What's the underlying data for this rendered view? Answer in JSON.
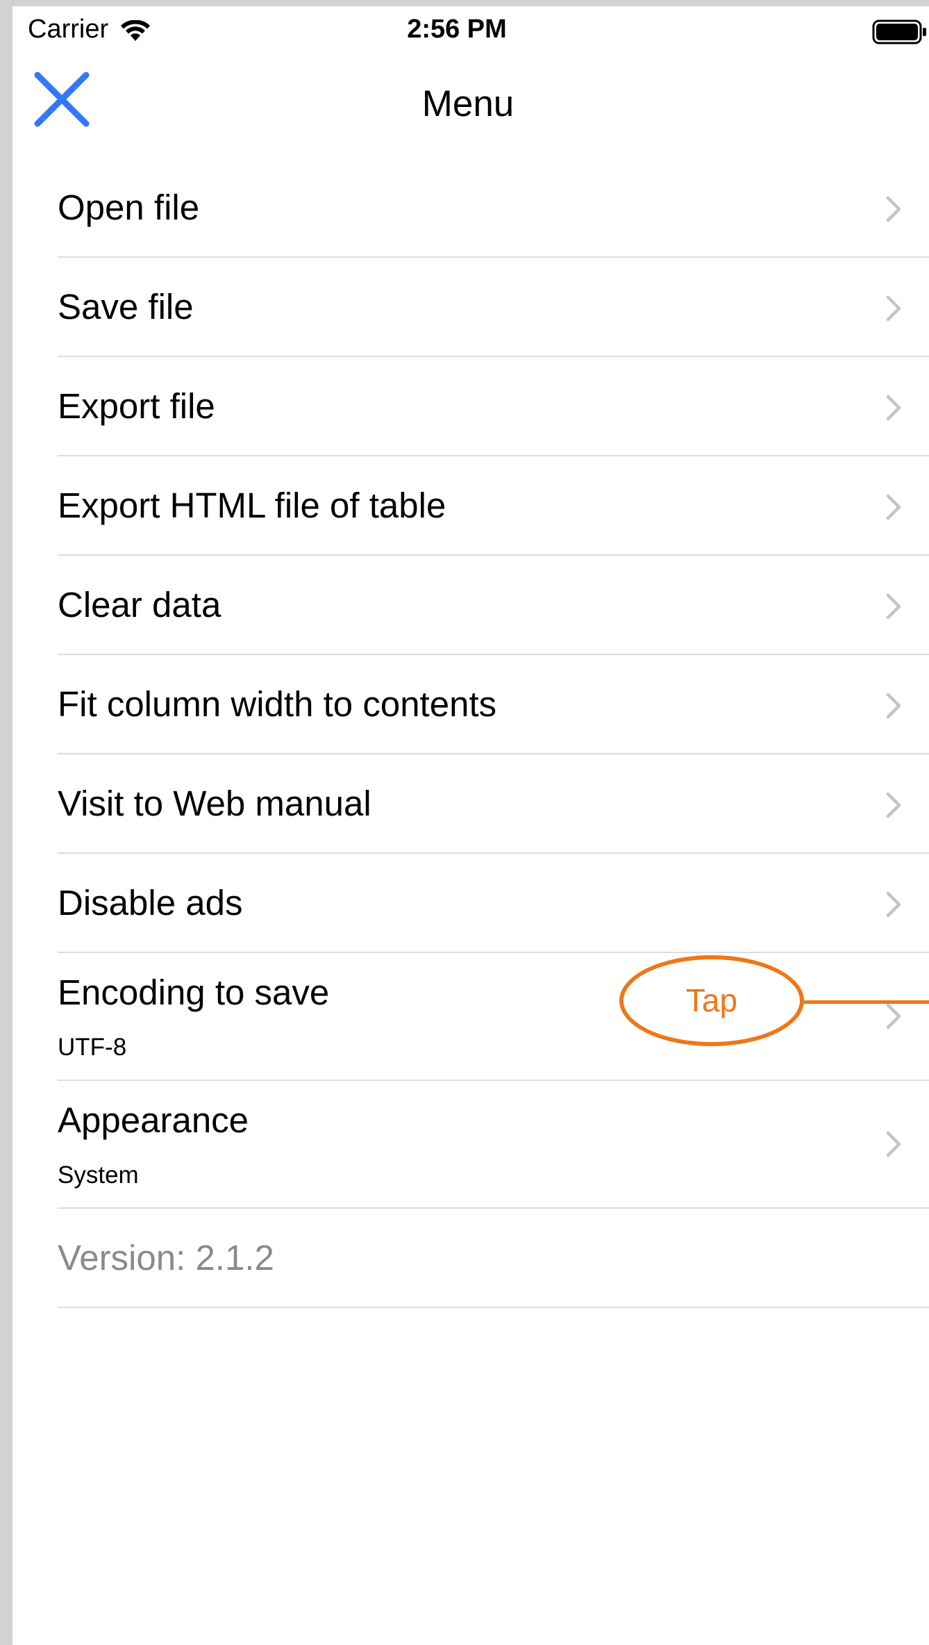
{
  "status_bar": {
    "carrier": "Carrier",
    "time": "2:56 PM",
    "wifi_icon": "wifi-icon",
    "battery_icon": "battery-icon"
  },
  "nav": {
    "title": "Menu",
    "close_icon": "close-icon",
    "accent_color": "#3478f6"
  },
  "menu": {
    "items": [
      {
        "label": "Open file"
      },
      {
        "label": "Save file"
      },
      {
        "label": "Export file"
      },
      {
        "label": "Export HTML file of table"
      },
      {
        "label": "Clear data"
      },
      {
        "label": "Fit column width to contents"
      },
      {
        "label": "Visit to Web manual"
      },
      {
        "label": "Disable ads"
      },
      {
        "label": "Encoding to save",
        "value": "UTF-8"
      },
      {
        "label": "Appearance",
        "value": "System"
      }
    ],
    "version": "Version: 2.1.2",
    "chevron_icon": "chevron-right-icon"
  },
  "annotation": {
    "label": "Tap",
    "color": "#ee7717"
  }
}
